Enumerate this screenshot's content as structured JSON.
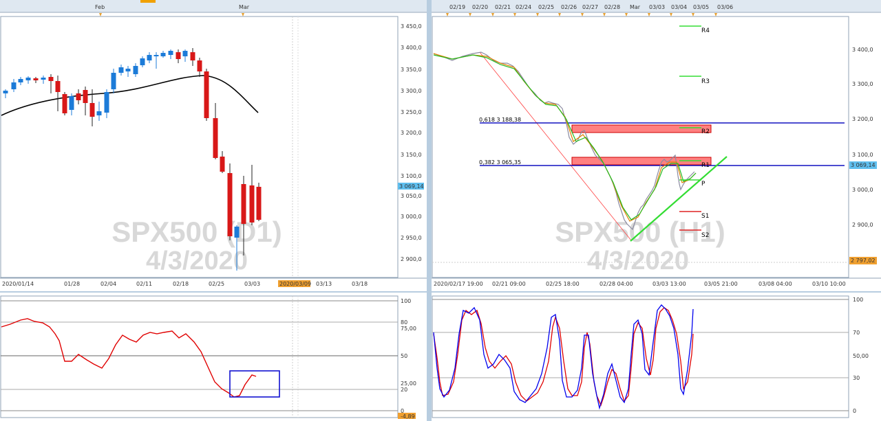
{
  "left": {
    "top_months": [
      "Feb",
      "Mar"
    ],
    "price_ticks": [
      "3 450,0",
      "3 400,0",
      "3 350,0",
      "3 300,0",
      "3 250,0",
      "3 200,0",
      "3 150,0",
      "3 100,0",
      "3 050,0",
      "3 000,0",
      "2 950,0",
      "2 900,0"
    ],
    "price_label": "3 069,14",
    "date_labels": [
      "2020/01/14",
      "01/28",
      "02/04",
      "02/11",
      "02/18",
      "02/25",
      "03/03",
      "2020/03/09",
      "03/13",
      "03/18"
    ],
    "watermark_line1": "SPX500 (D1)",
    "watermark_line2": "4/3/2020",
    "osc_ticks": [
      "100",
      "80",
      "75,00",
      "50",
      "25,00",
      "20",
      "0",
      "-4,89"
    ]
  },
  "right": {
    "top_dates": [
      "02/19",
      "02/20",
      "02/21",
      "02/24",
      "02/25",
      "02/26",
      "02/27",
      "02/28",
      "Mar",
      "03/03",
      "03/04",
      "03/05",
      "03/06"
    ],
    "price_ticks": [
      "3 400,0",
      "3 300,0",
      "3 200,0",
      "3 100,0",
      "3 000,0",
      "2 900,0"
    ],
    "price_label": "3 069,14",
    "low_label": "2 797,02",
    "fib_618": "0,618 3 188,38",
    "fib_382": "0,382 3 065,35",
    "pivots": [
      "R4",
      "R3",
      "R2",
      "R1",
      "P",
      "S1",
      "S2"
    ],
    "date_labels": [
      "2020/02/17 19:00",
      "02/21 09:00",
      "02/25 18:00",
      "02/28 04:00",
      "03/03 13:00",
      "03/05 21:00",
      "03/08 04:00",
      "03/10 10:00"
    ],
    "watermark_line1": "SPX500 (H1)",
    "watermark_line2": "4/3/2020",
    "osc_ticks": [
      "100",
      "70",
      "50,00",
      "30",
      "0"
    ]
  }
}
